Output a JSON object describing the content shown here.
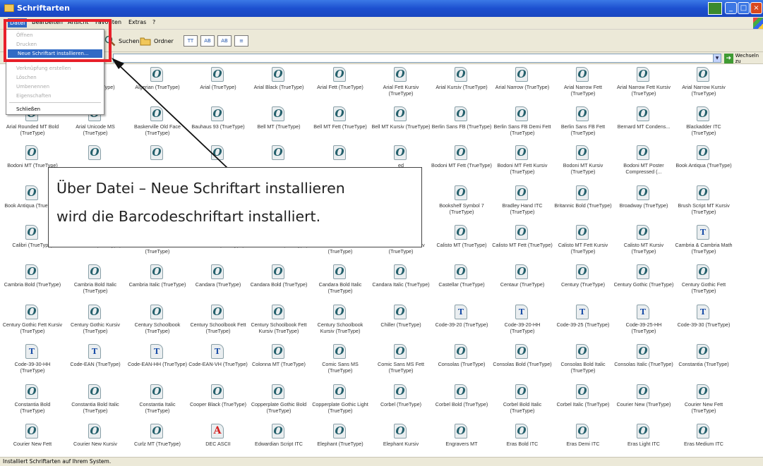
{
  "window": {
    "title": "Schriftarten"
  },
  "menu": {
    "items": [
      "Datei",
      "Bearbeiten",
      "Ansicht",
      "Favoriten",
      "Extras",
      "?"
    ]
  },
  "toolbar": {
    "search_label": "Suchen",
    "folders_label": "Ordner",
    "view_buttons": [
      "TT",
      "AB",
      "AB",
      "≡"
    ]
  },
  "address": {
    "go_label": "Wechseln zu"
  },
  "file_menu": {
    "items": [
      {
        "label": "Öffnen",
        "state": "disabled"
      },
      {
        "label": "Drucken",
        "state": "disabled"
      },
      {
        "label": "Neue Schriftart installieren...",
        "state": "highlight"
      },
      {
        "label": "Verknüpfung erstellen",
        "state": "disabled"
      },
      {
        "label": "Löschen",
        "state": "disabled"
      },
      {
        "label": "Umbenennen",
        "state": "disabled"
      },
      {
        "label": "Eigenschaften",
        "state": "disabled"
      },
      {
        "label": "Schließen",
        "state": "enabled"
      }
    ]
  },
  "callout": {
    "line1": "Über Datei – Neue Schriftart installieren",
    "line2": "wird die Barcodeschriftart installiert."
  },
  "fonts": [
    [
      "",
      "d Fett (TrueType)",
      "Algerian (TrueType)",
      "Arial (TrueType)",
      "Arial Black (TrueType)",
      "Arial Fett (TrueType)",
      "Arial Fett Kursiv (TrueType)",
      "Arial Kursiv (TrueType)",
      "Arial Narrow (TrueType)",
      "Arial Narrow Fett (TrueType)",
      "Arial Narrow Fett Kursiv (TrueType)",
      "Arial Narrow Kursiv (TrueType)"
    ],
    [
      "Arial Rounded MT Bold (TrueType)",
      "Arial Unicode MS (TrueType)",
      "Baskerville Old Face (TrueType)",
      "Bauhaus 93 (TrueType)",
      "Bell MT (TrueType)",
      "Bell MT Fett (TrueType)",
      "Bell MT Kursiv (TrueType)",
      "Berlin Sans FB (TrueType)",
      "Berlin Sans FB Demi Fett (TrueType)",
      "Berlin Sans FB Fett (TrueType)",
      "Bernard MT Condens...",
      "Blackadder ITC (TrueType)"
    ],
    [
      "Bodoni MT (TrueType)",
      "",
      "",
      "",
      "",
      "",
      "ed",
      "Bodoni MT Fett (TrueType)",
      "Bodoni MT Fett Kursiv (TrueType)",
      "Bodoni MT Kursiv (TrueType)",
      "Bodoni MT Poster Compressed (...",
      "Book Antiqua (TrueType)"
    ],
    [
      "Book Antiqua (TrueType)",
      "",
      "",
      "",
      "",
      "",
      "e",
      "Bookshelf Symbol 7 (TrueType)",
      "Bradley Hand ITC (TrueType)",
      "Britannic Bold (TrueType)",
      "Broadway (TrueType)",
      "Brush Script MT Kursiv (TrueType)"
    ],
    [
      "Calibri (TrueType)",
      "Calibri Bold (TrueType)",
      "Calibri Bold Italic (TrueType)",
      "Calibri Italic (TrueType)",
      "Californian FB (TrueType)",
      "Californian FB Fett (TrueType)",
      "Californian FB Kursiv (TrueType)",
      "Calisto MT (TrueType)",
      "Calisto MT Fett (TrueType)",
      "Calisto MT Fett Kursiv (TrueType)",
      "Calisto MT Kursiv (TrueType)",
      "Cambria & Cambria Math (TrueType)"
    ],
    [
      "Cambria Bold (TrueType)",
      "Cambria Bold Italic (TrueType)",
      "Cambria Italic (TrueType)",
      "Candara (TrueType)",
      "Candara Bold (TrueType)",
      "Candara Bold Italic (TrueType)",
      "Candara Italic (TrueType)",
      "Castellar (TrueType)",
      "Centaur (TrueType)",
      "Century (TrueType)",
      "Century Gothic (TrueType)",
      "Century Gothic Fett (TrueType)"
    ],
    [
      "Century Gothic Fett Kursiv (TrueType)",
      "Century Gothic Kursiv (TrueType)",
      "Century Schoolbook (TrueType)",
      "Century Schoolbook Fett (TrueType)",
      "Century Schoolbook Fett Kursiv (TrueType)",
      "Century Schoolbook Kursiv (TrueType)",
      "Chiller (TrueType)",
      "Code-39-20 (TrueType)",
      "Code-39-20-HH (TrueType)",
      "Code-39-25 (TrueType)",
      "Code-39-25-HH (TrueType)",
      "Code-39-30 (TrueType)"
    ],
    [
      "Code-39-30-HH (TrueType)",
      "Code-EAN (TrueType)",
      "Code-EAN-HH (TrueType)",
      "Code-EAN-VH (TrueType)",
      "Colonna MT (TrueType)",
      "Comic Sans MS (TrueType)",
      "Comic Sans MS Fett (TrueType)",
      "Consolas (TrueType)",
      "Consolas Bold (TrueType)",
      "Consolas Bold Italic (TrueType)",
      "Consolas Italic (TrueType)",
      "Constantia (TrueType)"
    ],
    [
      "Constantia Bold (TrueType)",
      "Constantia Bold Italic (TrueType)",
      "Constantia Italic (TrueType)",
      "Cooper Black (TrueType)",
      "Copperplate Gothic Bold (TrueType)",
      "Copperplate Gothic Light (TrueType)",
      "Corbel (TrueType)",
      "Corbel Bold (TrueType)",
      "Corbel Bold Italic (TrueType)",
      "Corbel Italic (TrueType)",
      "Courier New (TrueType)",
      "Courier New Fett (TrueType)"
    ],
    [
      "Courier New Fett",
      "Courier New Kursiv",
      "Curlz MT (TrueType)",
      "DEC ASCII",
      "Edwardian Script ITC",
      "Elephant (TrueType)",
      "Elephant Kursiv",
      "Engravers MT",
      "Eras Bold ITC",
      "Eras Demi ITC",
      "Eras Light ITC",
      "Eras Medium ITC"
    ]
  ],
  "status": {
    "text": "Installiert Schriftarten auf Ihrem System."
  }
}
